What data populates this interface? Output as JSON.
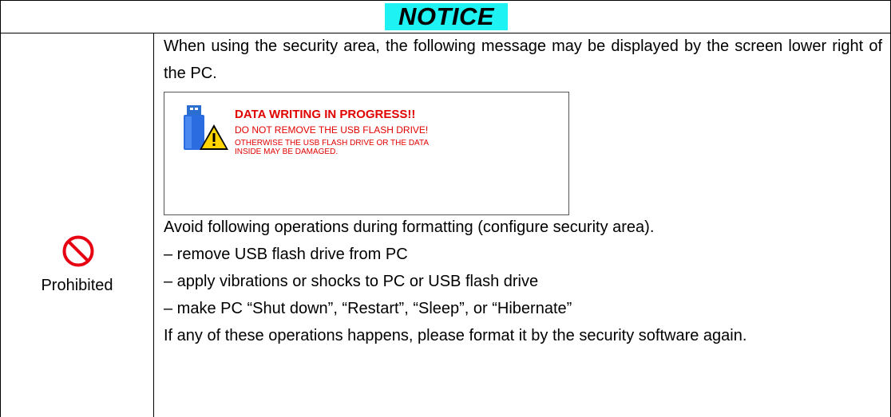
{
  "header": {
    "title": "NOTICE",
    "title_bg_color": "#1ef2f2"
  },
  "category": {
    "icon": "prohibited-icon",
    "label": "Prohibited",
    "icon_color": "#e60012"
  },
  "intro": "When using the security area, the following message may be displayed by the screen lower right of the PC.",
  "popup": {
    "icon": "usb-drive-warning-icon",
    "title": "DATA WRITING IN PROGRESS!!",
    "line1": "DO NOT REMOVE THE USB FLASH DRIVE!",
    "line2": "OTHERWISE THE USB FLASH DRIVE OR THE DATA INSIDE MAY BE DAMAGED.",
    "text_color": "#e10000"
  },
  "avoid_heading": "Avoid following operations during formatting (configure security area).",
  "operations": [
    "– remove USB flash drive from PC",
    "– apply vibrations or shocks to PC or USB flash drive",
    "– make PC “Shut down”, “Restart”, “Sleep”, or “Hibernate”"
  ],
  "closing": "If any of these operations happens, please format it by the security software again."
}
